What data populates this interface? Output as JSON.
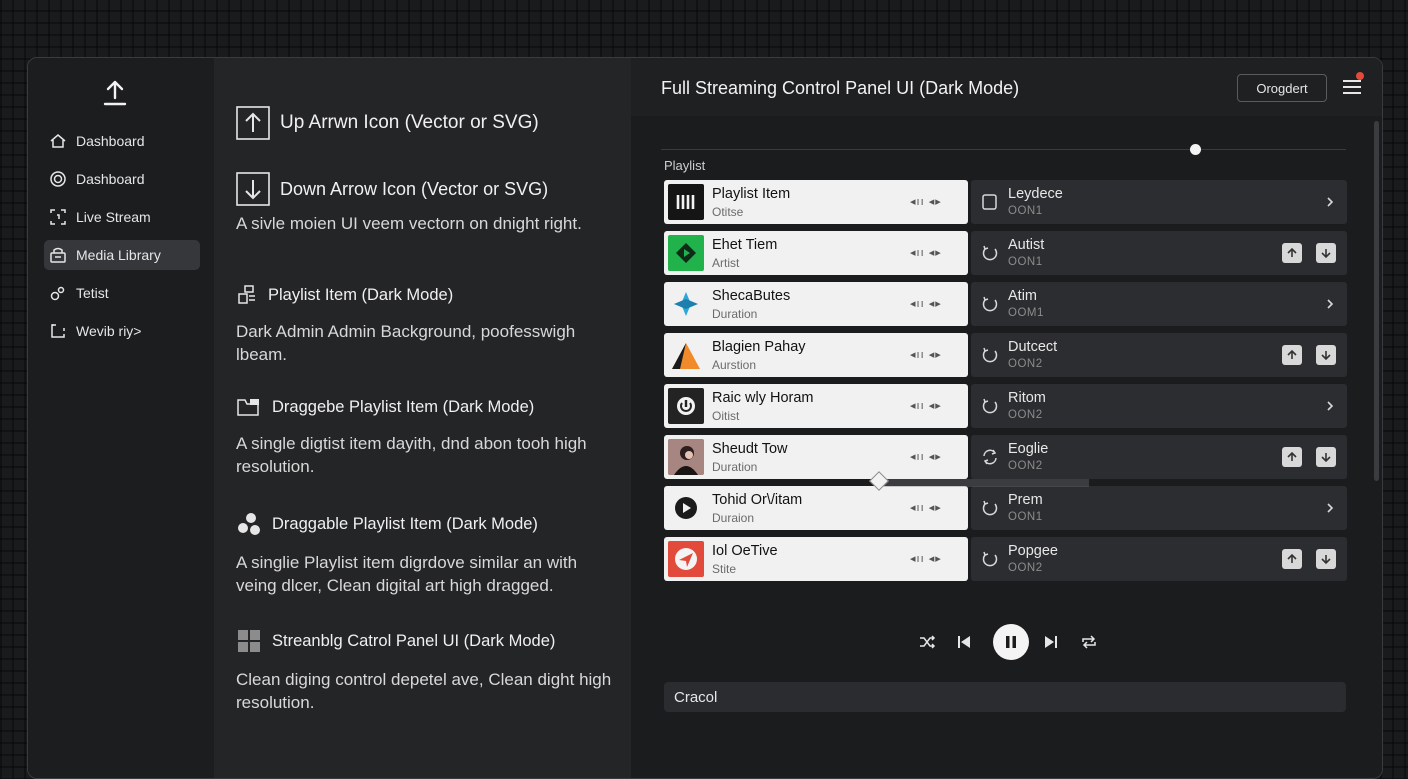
{
  "sidebar": {
    "items": [
      {
        "label": "Dashboard",
        "icon": "home-icon"
      },
      {
        "label": "Dashboard",
        "icon": "target-icon"
      },
      {
        "label": "Live Stream",
        "icon": "live-stream-icon"
      },
      {
        "label": "Media Library",
        "icon": "media-library-icon"
      },
      {
        "label": "Tetist",
        "icon": "link-icon"
      },
      {
        "label": "Wevib riy>",
        "icon": "window-icon"
      }
    ]
  },
  "doc": {
    "up_heading": "Up Arrwn Icon (Vector or SVG)",
    "down_heading": "Down Arrow Icon (Vector or SVG)",
    "down_text": "A sivle moien UI veem vectorn on dnight right.",
    "playlist_heading": "Playlist Item (Dark Mode)",
    "playlist_text": "Dark Admin Admin Background, poofesswigh lbeam.",
    "draggable1_heading": "Draggebe Playlist Item (Dark Mode)",
    "draggable1_text": "A single digtist item dayith, dnd abon tooh high resolution.",
    "draggable2_heading": "Draggable Playlist Item (Dark Mode)",
    "draggable2_text": "A singlie Playlist item digrdove similar an with veing dlcer, Clean digital art high dragged.",
    "panel_heading": "Streanblg Catrol Panel UI (Dark Mode)",
    "panel_text": "Clean diging control depetel ave, Clean dight high resolution."
  },
  "panel": {
    "title": "Full Streaming Control Panel UI (Dark Mode)",
    "header_button": "Orogdert",
    "section_label": "Playlist",
    "bottom_field": "Cracol",
    "playback_progress": 0.78
  },
  "playlist": [
    {
      "title": "Playlist Item",
      "sub": "Otitse",
      "ctl": "◂ıı ◂▸",
      "side_title": "Leydece",
      "side_sub": "OON1",
      "side_icon": "square",
      "action": "chevron"
    },
    {
      "title": "Ehet Tiem",
      "sub": "Artist",
      "ctl": "◂ıı ◂▸",
      "side_title": "Autist",
      "side_sub": "OON1",
      "side_icon": "refresh",
      "action": "move"
    },
    {
      "title": "ShecaButes",
      "sub": "Duration",
      "ctl": "◂ıı ◂▸",
      "side_title": "Atim",
      "side_sub": "OOM1",
      "side_icon": "refresh",
      "action": "chevron"
    },
    {
      "title": "Blagien Pahay",
      "sub": "Aurstion",
      "ctl": "◂ıı ◂▸",
      "side_title": "Dutcect",
      "side_sub": "OON2",
      "side_icon": "refresh",
      "action": "move"
    },
    {
      "title": "Raic wly Horam",
      "sub": "Oitist",
      "ctl": "◂ıı ◂▸",
      "side_title": "Ritom",
      "side_sub": "OON2",
      "side_icon": "refresh",
      "action": "chevron"
    },
    {
      "title": "Sheudt Tow",
      "sub": "Duration",
      "ctl": "◂ıı ◂▸",
      "side_title": "Eoglie",
      "side_sub": "OON2",
      "side_icon": "refresh",
      "action": "move"
    },
    {
      "title": "Tohid Or\\/itam",
      "sub": "Duraion",
      "ctl": "◂ıı ◂▸",
      "side_title": "Prem",
      "side_sub": "OON1",
      "side_icon": "refresh",
      "action": "chevron"
    },
    {
      "title": "Iol OeTive",
      "sub": "Stite",
      "ctl": "◂ıı ◂▸",
      "side_title": "Popgee",
      "side_sub": "OON2",
      "side_icon": "refresh",
      "action": "move"
    }
  ],
  "colors": {
    "accent_red": "#e24b3c",
    "thumb_green": "#22b24c",
    "thumb_blue": "#2aa9d8",
    "thumb_orange": "#f08a2a"
  }
}
